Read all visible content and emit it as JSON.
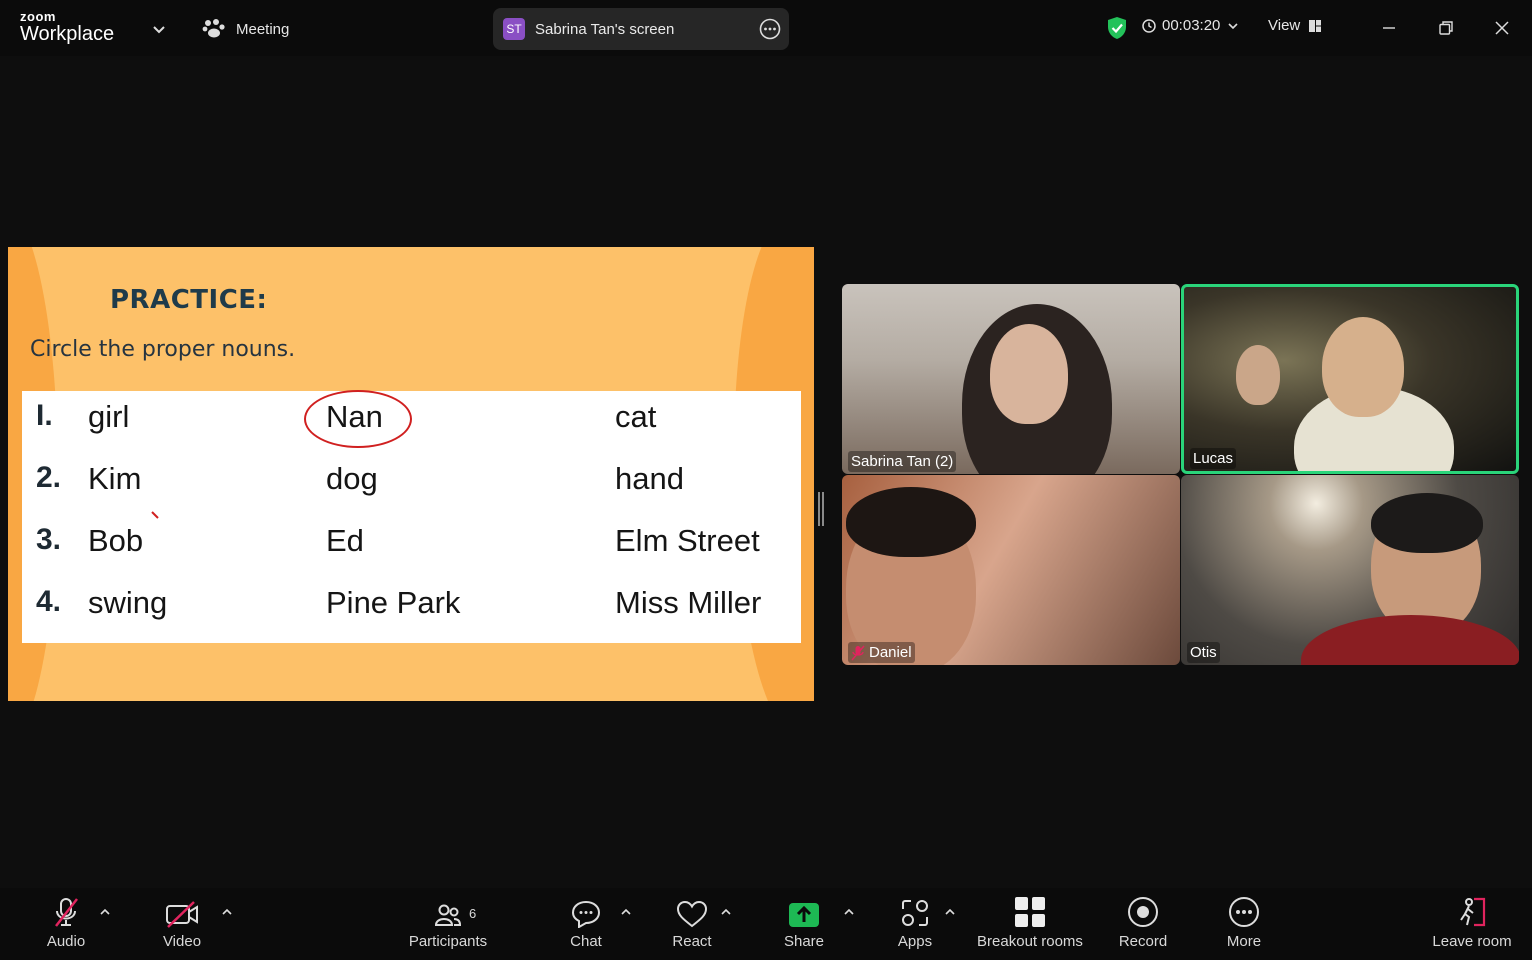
{
  "titlebar": {
    "logo_small": "zoom",
    "logo_big": "Workplace",
    "meeting_label": "Meeting",
    "share_badge": "ST",
    "share_label": "Sabrina Tan's screen",
    "timer": "00:03:20",
    "view_label": "View"
  },
  "slide": {
    "title": "PRACTICE:",
    "subtitle": "Circle the proper nouns.",
    "rows": [
      {
        "num": "I.",
        "words": [
          "girl",
          "Nan",
          "cat"
        ]
      },
      {
        "num": "2.",
        "words": [
          "Kim",
          "dog",
          "hand"
        ]
      },
      {
        "num": "3.",
        "words": [
          "Bob",
          "Ed",
          "Elm Street"
        ]
      },
      {
        "num": "4.",
        "words": [
          "swing",
          "Pine Park",
          "Miss Miller"
        ]
      }
    ]
  },
  "participants": [
    {
      "name": "Sabrina Tan (2)",
      "muted": false,
      "active": false
    },
    {
      "name": "Lucas",
      "muted": false,
      "active": true
    },
    {
      "name": "Daniel",
      "muted": true,
      "active": false
    },
    {
      "name": "Otis",
      "muted": false,
      "active": false
    }
  ],
  "toolbar": {
    "audio": "Audio",
    "video": "Video",
    "participants": "Participants",
    "participants_count": "6",
    "chat": "Chat",
    "react": "React",
    "share": "Share",
    "apps": "Apps",
    "breakout": "Breakout rooms",
    "record": "Record",
    "more": "More",
    "leave": "Leave room"
  },
  "colors": {
    "active_speaker": "#2ad47a",
    "share_green": "#1db954",
    "slide_bg": "#fdc169",
    "muted_red": "#e0245e"
  }
}
